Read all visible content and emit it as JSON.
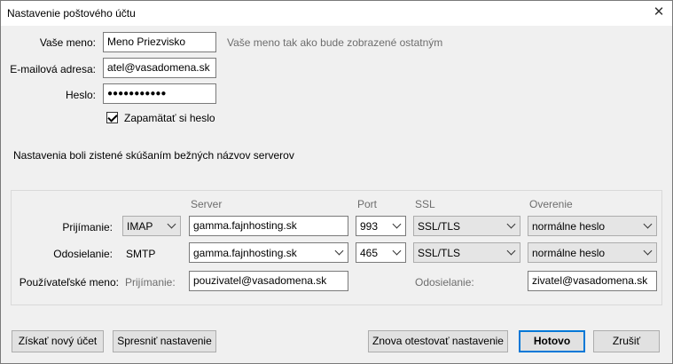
{
  "window": {
    "title": "Nastavenie poštového účtu"
  },
  "account": {
    "name_label": "Vaše meno:",
    "name_value": "Meno Priezvisko",
    "name_hint": "Vaše meno tak ako bude zobrazené ostatným",
    "email_label": "E-mailová adresa:",
    "email_value": "atel@vasadomena.sk",
    "password_label": "Heslo:",
    "password_value": "●●●●●●●●●●●",
    "remember_label": "Zapamätať si heslo",
    "remember_checked": true
  },
  "status_message": "Nastavenia boli zistené skúšaním bežných názvov serverov",
  "server_table": {
    "headers": {
      "server": "Server",
      "port": "Port",
      "ssl": "SSL",
      "auth": "Overenie"
    },
    "incoming": {
      "label": "Prijímanie:",
      "protocol": "IMAP",
      "server": "gamma.fajnhosting.sk",
      "port": "993",
      "ssl": "SSL/TLS",
      "auth": "normálne heslo"
    },
    "outgoing": {
      "label": "Odosielanie:",
      "protocol": "SMTP",
      "server": "gamma.fajnhosting.sk",
      "port": "465",
      "ssl": "SSL/TLS",
      "auth": "normálne heslo"
    },
    "username": {
      "label": "Používateľské meno:",
      "incoming_label": "Prijímanie:",
      "incoming_value": "pouzivatel@vasadomena.sk",
      "outgoing_label": "Odosielanie:",
      "outgoing_value": "zivatel@vasadomena.sk"
    }
  },
  "buttons": {
    "new_account": "Získať nový účet",
    "advanced": "Spresniť nastavenie",
    "retest": "Znova otestovať nastavenie",
    "done": "Hotovo",
    "cancel": "Zrušiť"
  }
}
